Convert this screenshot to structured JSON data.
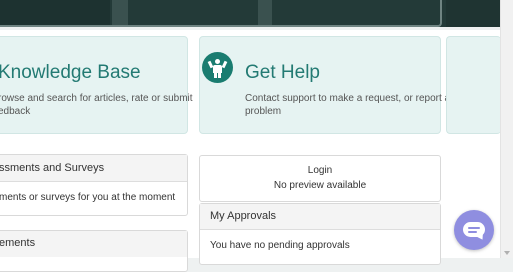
{
  "knowledge_base": {
    "title": "Knowledge Base",
    "description_line1": "rowse and search for articles, rate or submit",
    "description_line2": "edback"
  },
  "get_help": {
    "title": "Get Help",
    "description_line1": "Contact support to make a request, or report a",
    "description_line2": "problem",
    "icon": "person-help-icon"
  },
  "assessments": {
    "header": "ssments and Surveys",
    "body": "ments or surveys for you at the moment"
  },
  "announcements": {
    "header": "ements"
  },
  "login_preview": {
    "title": "Login",
    "body": "No preview available"
  },
  "approvals": {
    "header": "My Approvals",
    "body": "You have no pending approvals"
  },
  "chat": {
    "icon": "chat-bubble-icon",
    "color": "#8f8ee0"
  },
  "colors": {
    "accent": "#237a73",
    "hero": "#233a38"
  }
}
